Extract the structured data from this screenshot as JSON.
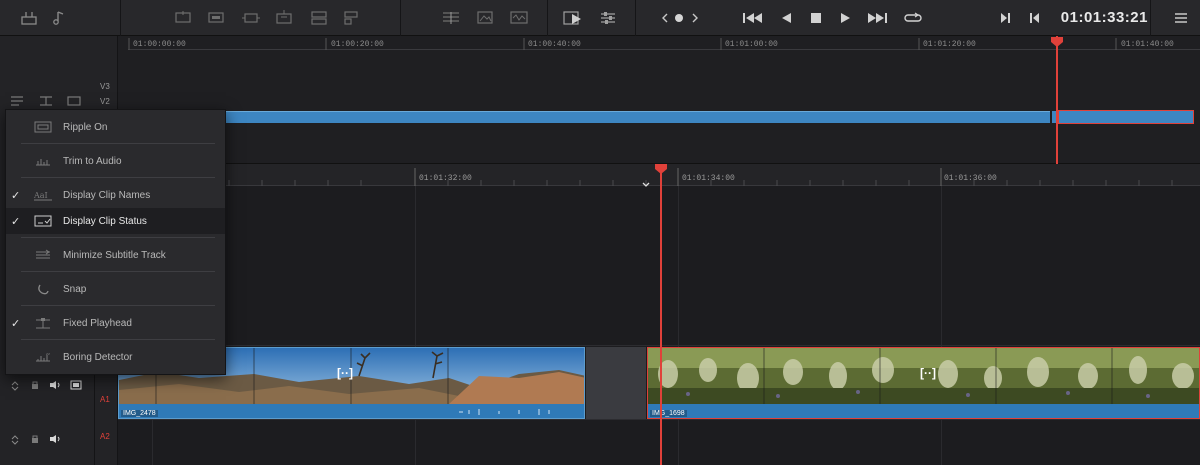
{
  "toolbar": {
    "timecode": "01:01:33:21"
  },
  "upper_timeline": {
    "ruler_ticks": [
      "01:00:00:00",
      "01:00:20:00",
      "01:00:40:00",
      "01:01:00:00",
      "01:01:20:00",
      "01:01:40:00"
    ],
    "tracks": [
      "V3",
      "V2"
    ]
  },
  "lower_timeline": {
    "ruler_ticks": [
      "01:01:32:00",
      "01:01:34:00",
      "01:01:36:00"
    ],
    "tracks": {
      "a1": "A1",
      "a2": "A2"
    },
    "clips": [
      {
        "name": "IMG_2478",
        "marker": "[··]"
      },
      {
        "name": "IMG_1698",
        "marker": "[··]"
      }
    ]
  },
  "menu": {
    "items": [
      {
        "label": "Ripple On",
        "checked": false,
        "icon": "ripple-icon"
      },
      {
        "label": "Trim to Audio",
        "checked": false,
        "icon": "trim-audio-icon"
      },
      {
        "label": "Display Clip Names",
        "checked": true,
        "icon": "clip-names-icon"
      },
      {
        "label": "Display Clip Status",
        "checked": true,
        "icon": "clip-status-icon"
      },
      {
        "label": "Minimize Subtitle Track",
        "checked": false,
        "icon": "subtitle-icon"
      },
      {
        "label": "Snap",
        "checked": false,
        "icon": "snap-icon"
      },
      {
        "label": "Fixed Playhead",
        "checked": true,
        "icon": "fixed-playhead-icon"
      },
      {
        "label": "Boring Detector",
        "checked": false,
        "icon": "boring-detector-icon"
      }
    ],
    "check_glyph": "✓"
  },
  "colors": {
    "accent_red": "#e0413a",
    "clip_blue": "#2f7ab8",
    "background": "#1f1f22"
  }
}
